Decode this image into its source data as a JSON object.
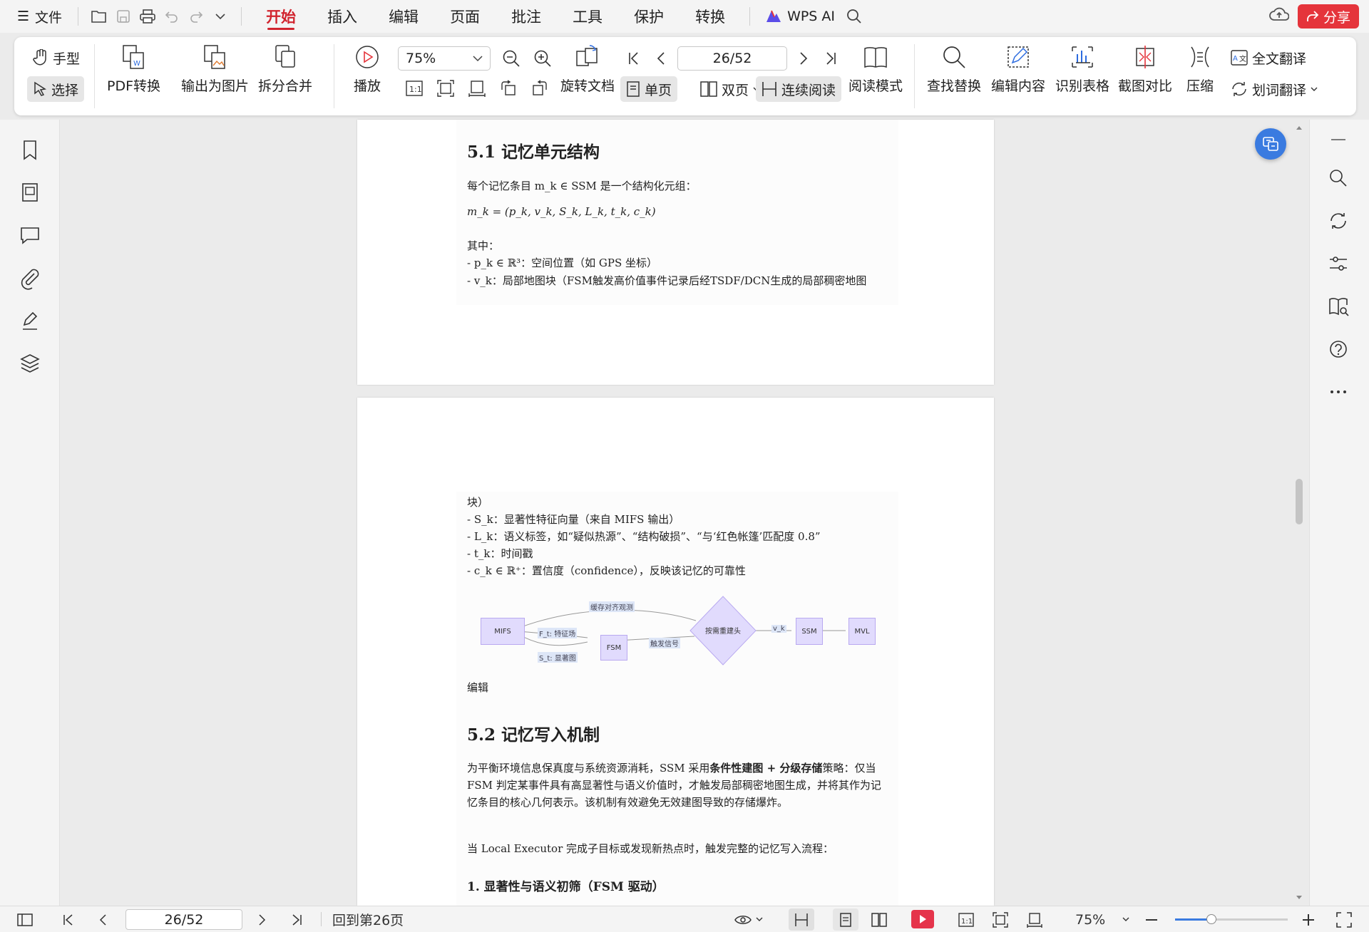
{
  "menubar": {
    "file_label": "文件",
    "tabs": [
      "开始",
      "插入",
      "编辑",
      "页面",
      "批注",
      "工具",
      "保护",
      "转换"
    ],
    "active_tab": "开始",
    "wps_ai_label": "WPS AI",
    "share_label": "分享"
  },
  "ribbon": {
    "hand_label": "手型",
    "select_label": "选择",
    "pdf_convert_label": "PDF转换",
    "export_image_label": "输出为图片",
    "split_merge_label": "拆分合并",
    "play_label": "播放",
    "zoom_value": "75%",
    "page_value": "26/52",
    "rotate_label": "旋转文档",
    "single_page_label": "单页",
    "double_page_label": "双页",
    "continuous_label": "连续阅读",
    "read_mode_label": "阅读模式",
    "find_replace_label": "查找替换",
    "edit_content_label": "编辑内容",
    "recognize_table_label": "识别表格",
    "screenshot_compare_label": "截图对比",
    "compress_label": "压缩",
    "full_translate_label": "全文翻译",
    "word_translate_label": "划词翻译"
  },
  "doc": {
    "page1": {
      "heading": "5.1 记忆单元结构",
      "line1": "每个记忆条目 m_k ∈ SSM 是一个结构化元组：",
      "formula": "m_k = (p_k, v_k, S_k, L_k, t_k, c_k)",
      "where_label": "其中：",
      "bullet_p": "- p_k ∈ ℝ³：空间位置（如 GPS 坐标）",
      "bullet_v": "- v_k：局部地图块（FSM触发高价值事件记录后经TSDF/DCN生成的局部稠密地图"
    },
    "page2": {
      "cont": "块）",
      "bullet_s": "- S_k：显著性特征向量（来自 MIFS 输出）",
      "bullet_l": "- L_k：语义标签，如“疑似热源”、“结构破损”、“与‘红色帐篷’匹配度 0.8”",
      "bullet_t": "- t_k：时间戳",
      "bullet_c": "- c_k ∈ ℝ⁺：置信度（confidence），反映该记忆的可靠性",
      "diagram": {
        "nodes": [
          "MIFS",
          "FSM",
          "按需重建头",
          "SSM",
          "MVL"
        ],
        "edges": [
          "缓存对齐观测",
          "F_t: 特征场",
          "S_t: 显著图",
          "触发信号",
          "v_k"
        ]
      },
      "edit_label": "编辑",
      "heading2": "5.2 记忆写入机制",
      "para1_a": "为平衡环境信息保真度与系统资源消耗，SSM 采用",
      "para1_bold": "条件性建图 + 分级存储",
      "para1_b": "策略：仅当 FSM 判定某事件具有高显著性与语义价值时，才触发局部稠密地图生成，并将其作为记忆条目的核心几何表示。该机制有效避免无效建图导致的存储爆炸。",
      "para2": "当 Local Executor 完成子目标或发现新热点时，触发完整的记忆写入流程：",
      "heading3": "1. 显著性与语义初筛（FSM 驱动）"
    }
  },
  "statusbar": {
    "page_value": "26/52",
    "goto_label": "回到第26页",
    "zoom_value": "75%",
    "zoom_fraction": 0.32
  }
}
